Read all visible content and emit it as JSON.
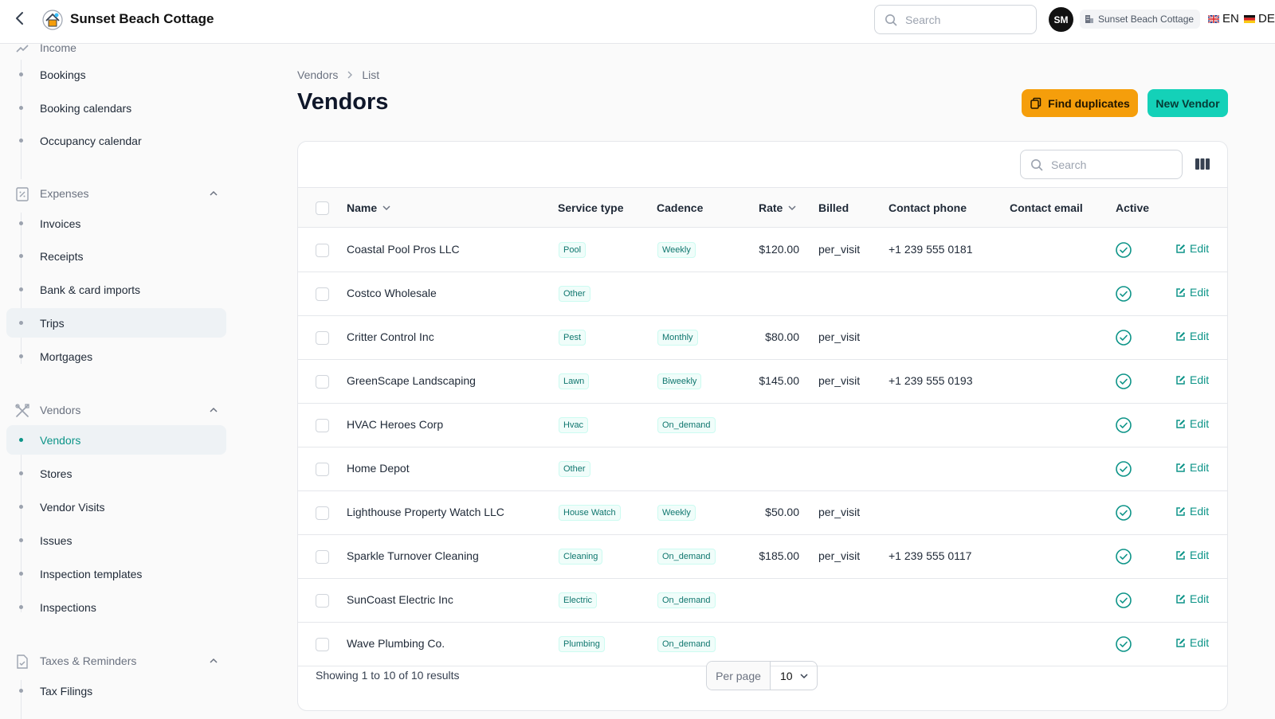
{
  "app": {
    "title": "Sunset Beach Cottage"
  },
  "topbar": {
    "search_placeholder": "Search",
    "avatar_initials": "SM",
    "tenant_name": "Sunset Beach Cottage",
    "lang_en": "EN",
    "lang_de": "DE"
  },
  "sidebar": {
    "partial_top_label": "Income",
    "income_items": [
      "Bookings",
      "Booking calendars",
      "Occupancy calendar"
    ],
    "expenses": {
      "label": "Expenses",
      "items": [
        "Invoices",
        "Receipts",
        "Bank & card imports",
        "Trips",
        "Mortgages"
      ]
    },
    "vendors": {
      "label": "Vendors",
      "items": [
        "Vendors",
        "Stores",
        "Vendor Visits",
        "Issues",
        "Inspection templates",
        "Inspections"
      ]
    },
    "taxes": {
      "label": "Taxes & Reminders",
      "items": [
        "Tax Filings"
      ]
    }
  },
  "breadcrumb": {
    "root": "Vendors",
    "current": "List"
  },
  "page": {
    "title": "Vendors",
    "find_duplicates_label": "Find duplicates",
    "new_vendor_label": "New Vendor"
  },
  "table": {
    "search_placeholder": "Search",
    "columns": {
      "name": "Name",
      "service_type": "Service type",
      "cadence": "Cadence",
      "rate": "Rate",
      "billed": "Billed",
      "contact_phone": "Contact phone",
      "contact_email": "Contact email",
      "active": "Active"
    },
    "edit_label": "Edit",
    "rows": [
      {
        "name": "Coastal Pool Pros LLC",
        "service_type": "Pool",
        "cadence": "Weekly",
        "rate": "$120.00",
        "billed": "per_visit",
        "phone": "+1 239 555 0181",
        "email": ""
      },
      {
        "name": "Costco Wholesale",
        "service_type": "Other",
        "cadence": "",
        "rate": "",
        "billed": "",
        "phone": "",
        "email": ""
      },
      {
        "name": "Critter Control Inc",
        "service_type": "Pest",
        "cadence": "Monthly",
        "rate": "$80.00",
        "billed": "per_visit",
        "phone": "",
        "email": ""
      },
      {
        "name": "GreenScape Landscaping",
        "service_type": "Lawn",
        "cadence": "Biweekly",
        "rate": "$145.00",
        "billed": "per_visit",
        "phone": "+1 239 555 0193",
        "email": ""
      },
      {
        "name": "HVAC Heroes Corp",
        "service_type": "Hvac",
        "cadence": "On_demand",
        "rate": "",
        "billed": "",
        "phone": "",
        "email": ""
      },
      {
        "name": "Home Depot",
        "service_type": "Other",
        "cadence": "",
        "rate": "",
        "billed": "",
        "phone": "",
        "email": ""
      },
      {
        "name": "Lighthouse Property Watch LLC",
        "service_type": "House Watch",
        "cadence": "Weekly",
        "rate": "$50.00",
        "billed": "per_visit",
        "phone": "",
        "email": ""
      },
      {
        "name": "Sparkle Turnover Cleaning",
        "service_type": "Cleaning",
        "cadence": "On_demand",
        "rate": "$185.00",
        "billed": "per_visit",
        "phone": "+1 239 555 0117",
        "email": ""
      },
      {
        "name": "SunCoast Electric Inc",
        "service_type": "Electric",
        "cadence": "On_demand",
        "rate": "",
        "billed": "",
        "phone": "",
        "email": ""
      },
      {
        "name": "Wave Plumbing Co.",
        "service_type": "Plumbing",
        "cadence": "On_demand",
        "rate": "",
        "billed": "",
        "phone": "",
        "email": ""
      }
    ],
    "footer": {
      "showing": "Showing 1 to 10 of 10 results",
      "per_page_label": "Per page",
      "per_page_value": "10"
    }
  },
  "colors": {
    "accent": "#0d9488",
    "warning_button": "#f59e0b",
    "primary_button": "#14d1b8"
  }
}
